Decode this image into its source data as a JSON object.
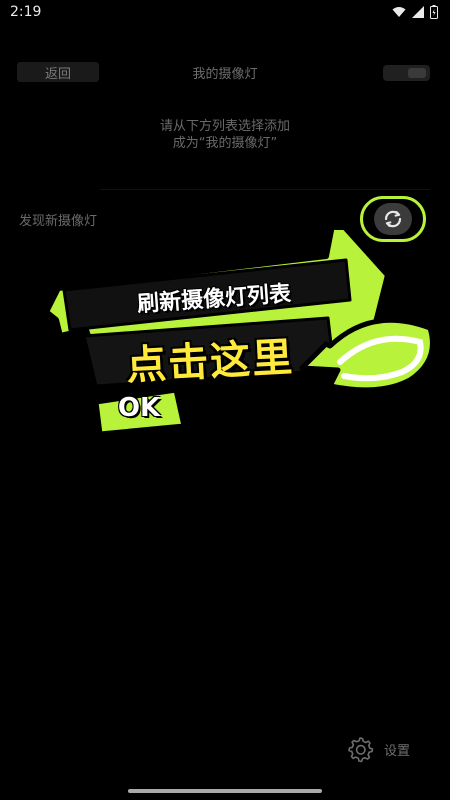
{
  "status_bar": {
    "time": "2:19"
  },
  "header": {
    "back_label": "返回",
    "title": "我的摄像灯"
  },
  "instruction": {
    "line1": "请从下方列表选择添加",
    "line2": "成为“我的摄像灯”"
  },
  "section": {
    "title": "发现新摄像灯"
  },
  "overlay": {
    "title": "刷新摄像灯列表",
    "main_text": "点击这里",
    "ok_label": "OK"
  },
  "footer": {
    "settings_label": "设置"
  },
  "colors": {
    "accent_green": "#b8f23a",
    "highlight_yellow": "#ffea3c",
    "background": "#000000"
  },
  "icons": {
    "refresh": "refresh-icon",
    "settings": "gear-icon",
    "wifi": "wifi-icon",
    "signal": "signal-icon",
    "battery": "battery-icon"
  }
}
